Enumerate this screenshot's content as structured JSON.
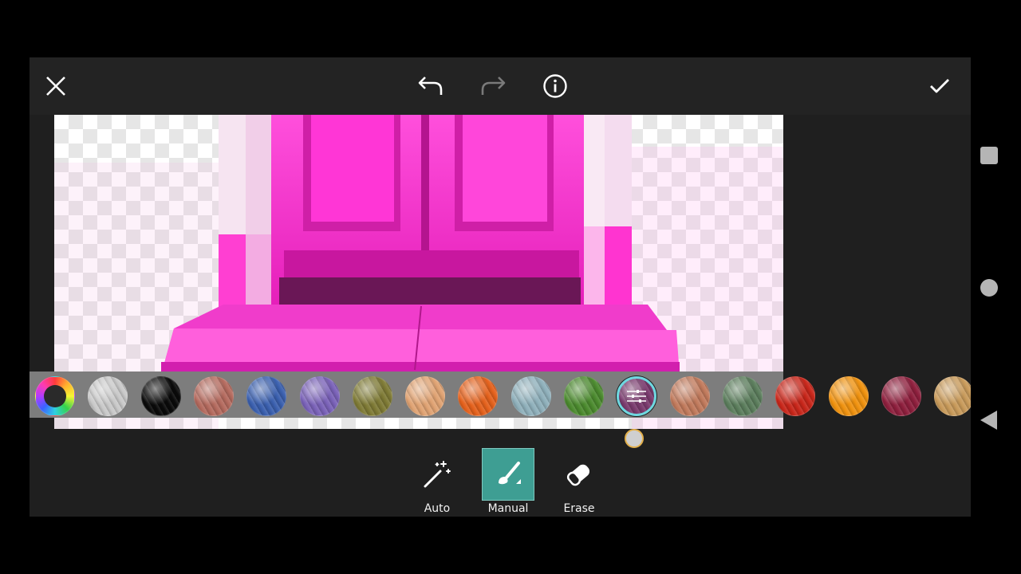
{
  "toolbar": {
    "close_icon": "close-icon",
    "undo_icon": "undo-icon",
    "redo_icon": "redo-icon",
    "info_icon": "info-icon",
    "apply_icon": "check-icon"
  },
  "colors": {
    "accent": "#3e9e93",
    "selection_ring": "#6fd8e0",
    "door": "#ff2fd0"
  },
  "swatches": [
    {
      "name": "color-wheel",
      "color": "#ffffff"
    },
    {
      "name": "silver",
      "color": "#c9c9c9"
    },
    {
      "name": "black",
      "color": "#0a0a0a"
    },
    {
      "name": "rose-brown",
      "color": "#b46a5e"
    },
    {
      "name": "blue",
      "color": "#3a5fae"
    },
    {
      "name": "violet",
      "color": "#7a62b8"
    },
    {
      "name": "olive",
      "color": "#7e7a35"
    },
    {
      "name": "peach",
      "color": "#e0a373"
    },
    {
      "name": "orange",
      "color": "#e4611c"
    },
    {
      "name": "steel-blue",
      "color": "#8fb0bb"
    },
    {
      "name": "green",
      "color": "#4b8a2e"
    },
    {
      "name": "plum",
      "color": "#7a3b6e",
      "selected": true
    },
    {
      "name": "copper",
      "color": "#c17a5c"
    },
    {
      "name": "sage",
      "color": "#5b7d5c"
    },
    {
      "name": "red",
      "color": "#c8261a"
    },
    {
      "name": "amber",
      "color": "#f0920f"
    },
    {
      "name": "crimson",
      "color": "#8e1f3d"
    },
    {
      "name": "sand",
      "color": "#c89a5a"
    }
  ],
  "tools": {
    "auto_label": "Auto",
    "manual_label": "Manual",
    "erase_label": "Erase",
    "active": "Manual"
  }
}
